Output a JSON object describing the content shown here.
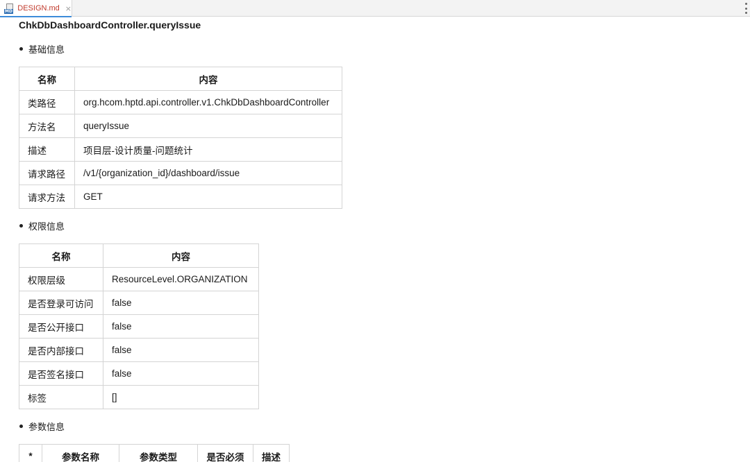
{
  "tab": {
    "icon": "markdown-file-icon",
    "badge": "MD",
    "filename": "DESIGN.md",
    "close": "×"
  },
  "doc": {
    "heading": "ChkDbDashboardController.queryIssue",
    "sections": {
      "basic": {
        "title": "基础信息",
        "headers": [
          "名称",
          "内容"
        ],
        "rows": [
          [
            "类路径",
            "org.hcom.hptd.api.controller.v1.ChkDbDashboardController"
          ],
          [
            "方法名",
            "queryIssue"
          ],
          [
            "描述",
            "项目层-设计质量-问题统计"
          ],
          [
            "请求路径",
            "/v1/{organization_id}/dashboard/issue"
          ],
          [
            "请求方法",
            "GET"
          ]
        ]
      },
      "permission": {
        "title": "权限信息",
        "headers": [
          "名称",
          "内容"
        ],
        "rows": [
          [
            "权限层级",
            "ResourceLevel.ORGANIZATION"
          ],
          [
            "是否登录可访问",
            "false"
          ],
          [
            "是否公开接口",
            "false"
          ],
          [
            "是否内部接口",
            "false"
          ],
          [
            "是否签名接口",
            "false"
          ],
          [
            "标签",
            "[]"
          ]
        ]
      },
      "params": {
        "title": "参数信息",
        "headers": [
          "*",
          "参数名称",
          "参数类型",
          "是否必须",
          "描述"
        ]
      }
    }
  }
}
